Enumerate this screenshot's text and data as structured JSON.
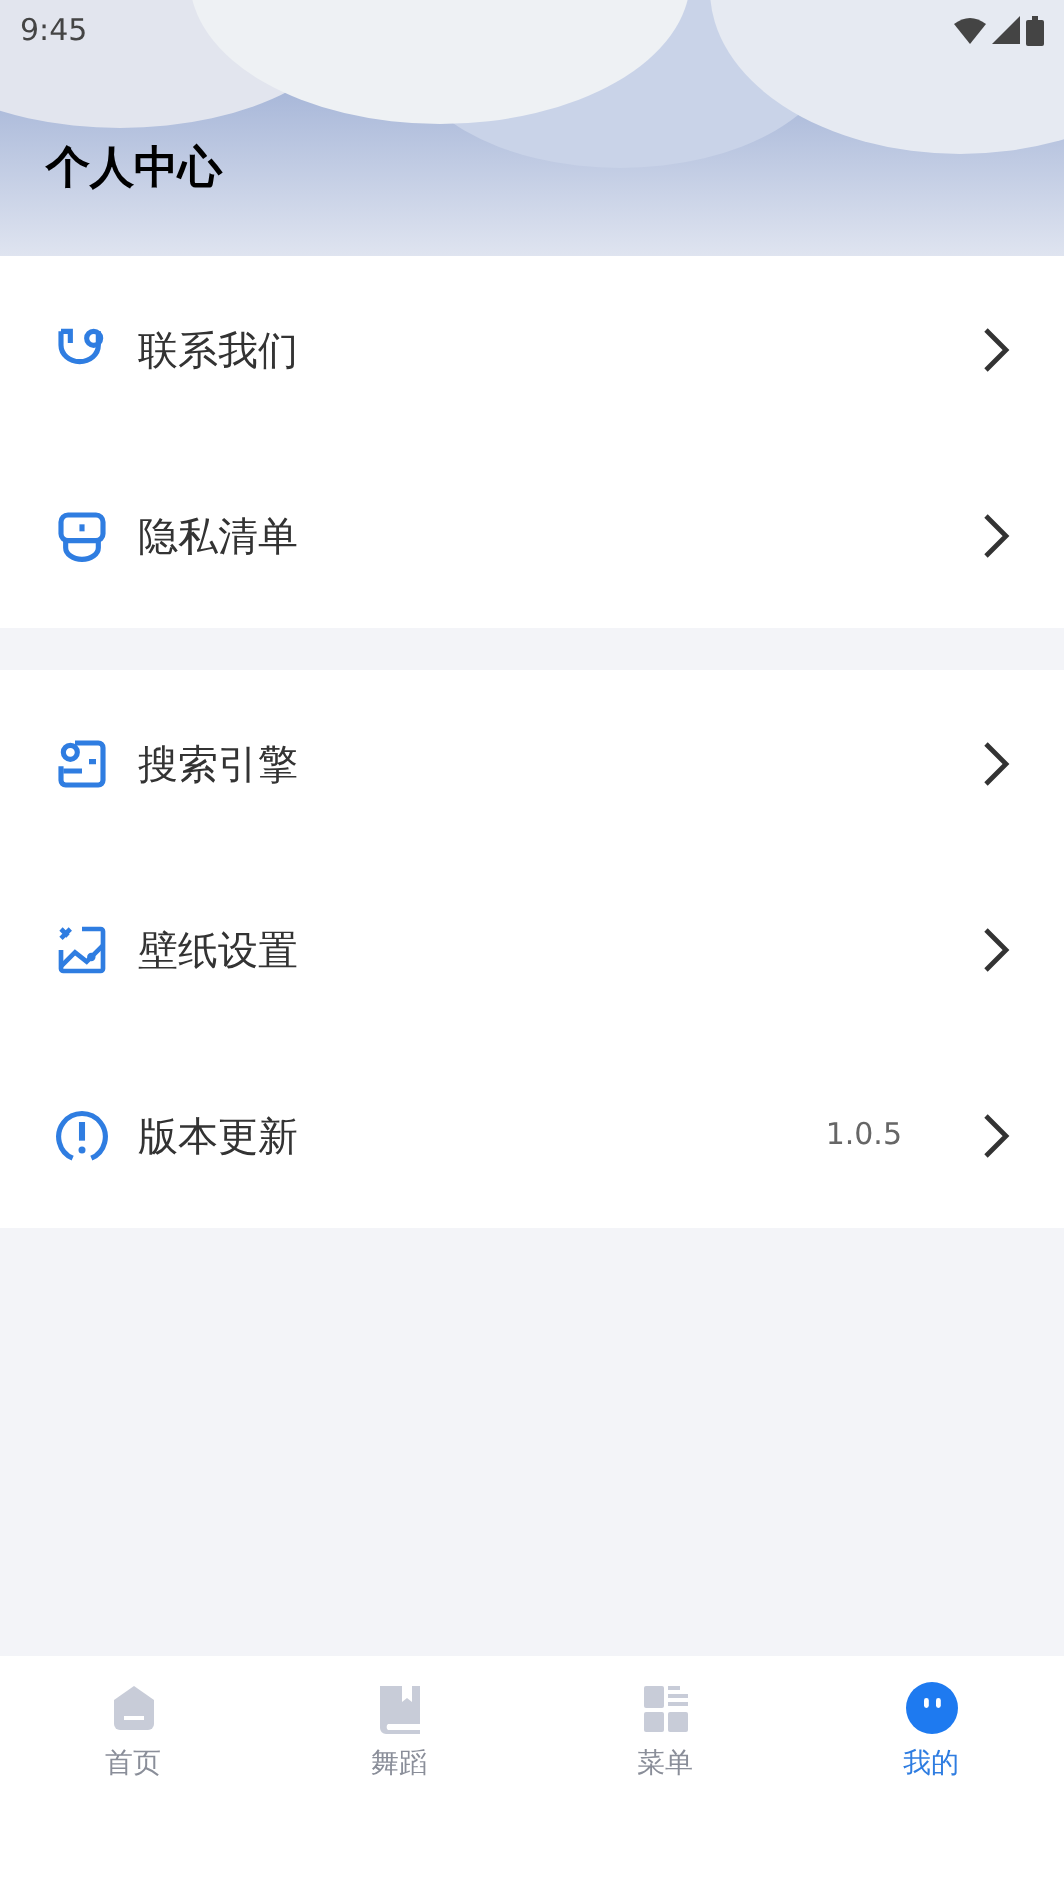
{
  "status_bar": {
    "time": "9:45"
  },
  "header": {
    "title": "个人中心"
  },
  "groups": [
    {
      "items": [
        {
          "kind": "contact",
          "label": "联系我们"
        },
        {
          "kind": "privacy",
          "label": "隐私清单"
        }
      ]
    },
    {
      "items": [
        {
          "kind": "search",
          "label": "搜索引擎"
        },
        {
          "kind": "wallpaper",
          "label": "壁纸设置"
        },
        {
          "kind": "update",
          "label": "版本更新",
          "value": "1.0.5"
        }
      ]
    }
  ],
  "bottom_nav": [
    {
      "kind": "home",
      "label": "首页",
      "selected": false
    },
    {
      "kind": "book",
      "label": "舞蹈",
      "selected": false
    },
    {
      "kind": "menu",
      "label": "菜单",
      "selected": false
    },
    {
      "kind": "me",
      "label": "我的",
      "selected": true
    }
  ]
}
